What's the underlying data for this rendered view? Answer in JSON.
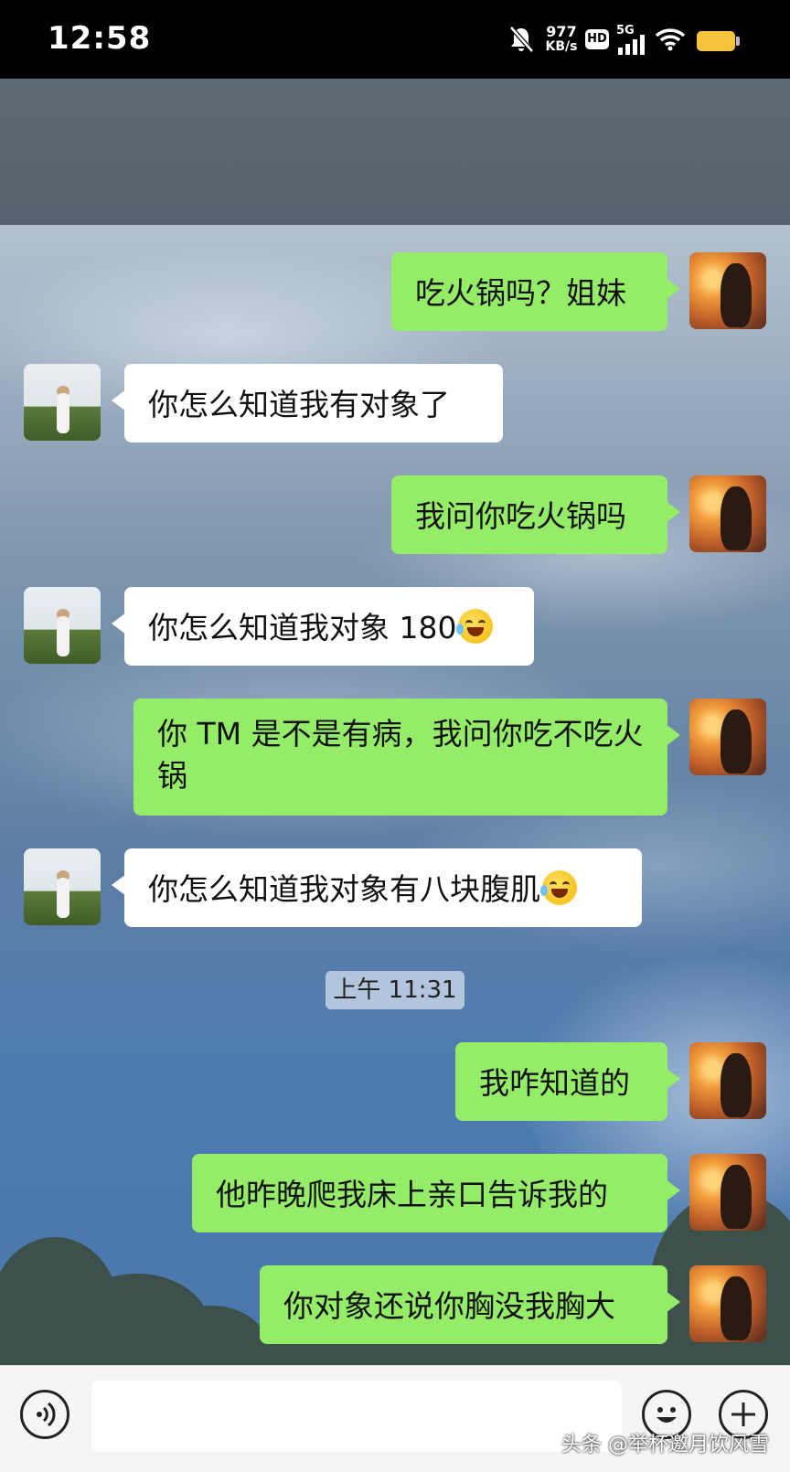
{
  "status_bar": {
    "time": "12:58",
    "net_speed_value": "977",
    "net_speed_unit": "KB/s",
    "hd_label": "HD",
    "network_type": "5G",
    "battery_color": "#f5c43c"
  },
  "chat": {
    "timestamp": "上午 11:31",
    "messages": [
      {
        "sender": "me",
        "text": "吃火锅吗？姐妹"
      },
      {
        "sender": "other",
        "text": "你怎么知道我有对象了"
      },
      {
        "sender": "me",
        "text": "我问你吃火锅吗"
      },
      {
        "sender": "other",
        "text": "你怎么知道我对象 180",
        "emoji": "rolling-laughing-emoji"
      },
      {
        "sender": "me",
        "text": "你 TM 是不是有病，我问你吃不吃火锅"
      },
      {
        "sender": "other",
        "text": "你怎么知道我对象有八块腹肌",
        "emoji": "tears-of-joy-emoji"
      },
      {
        "sender": "me",
        "text": "我咋知道的"
      },
      {
        "sender": "me",
        "text": "他昨晚爬我床上亲口告诉我的"
      },
      {
        "sender": "me",
        "text": "你对象还说你胸没我胸大"
      }
    ]
  },
  "colors": {
    "my_bubble": "#95ec69",
    "other_bubble": "#ffffff"
  },
  "input_bar": {
    "voice_icon": "voice-icon",
    "emoji_icon": "smiley-icon",
    "plus_icon": "plus-icon"
  },
  "watermark": "头条 @举杯邀月饮风雪"
}
